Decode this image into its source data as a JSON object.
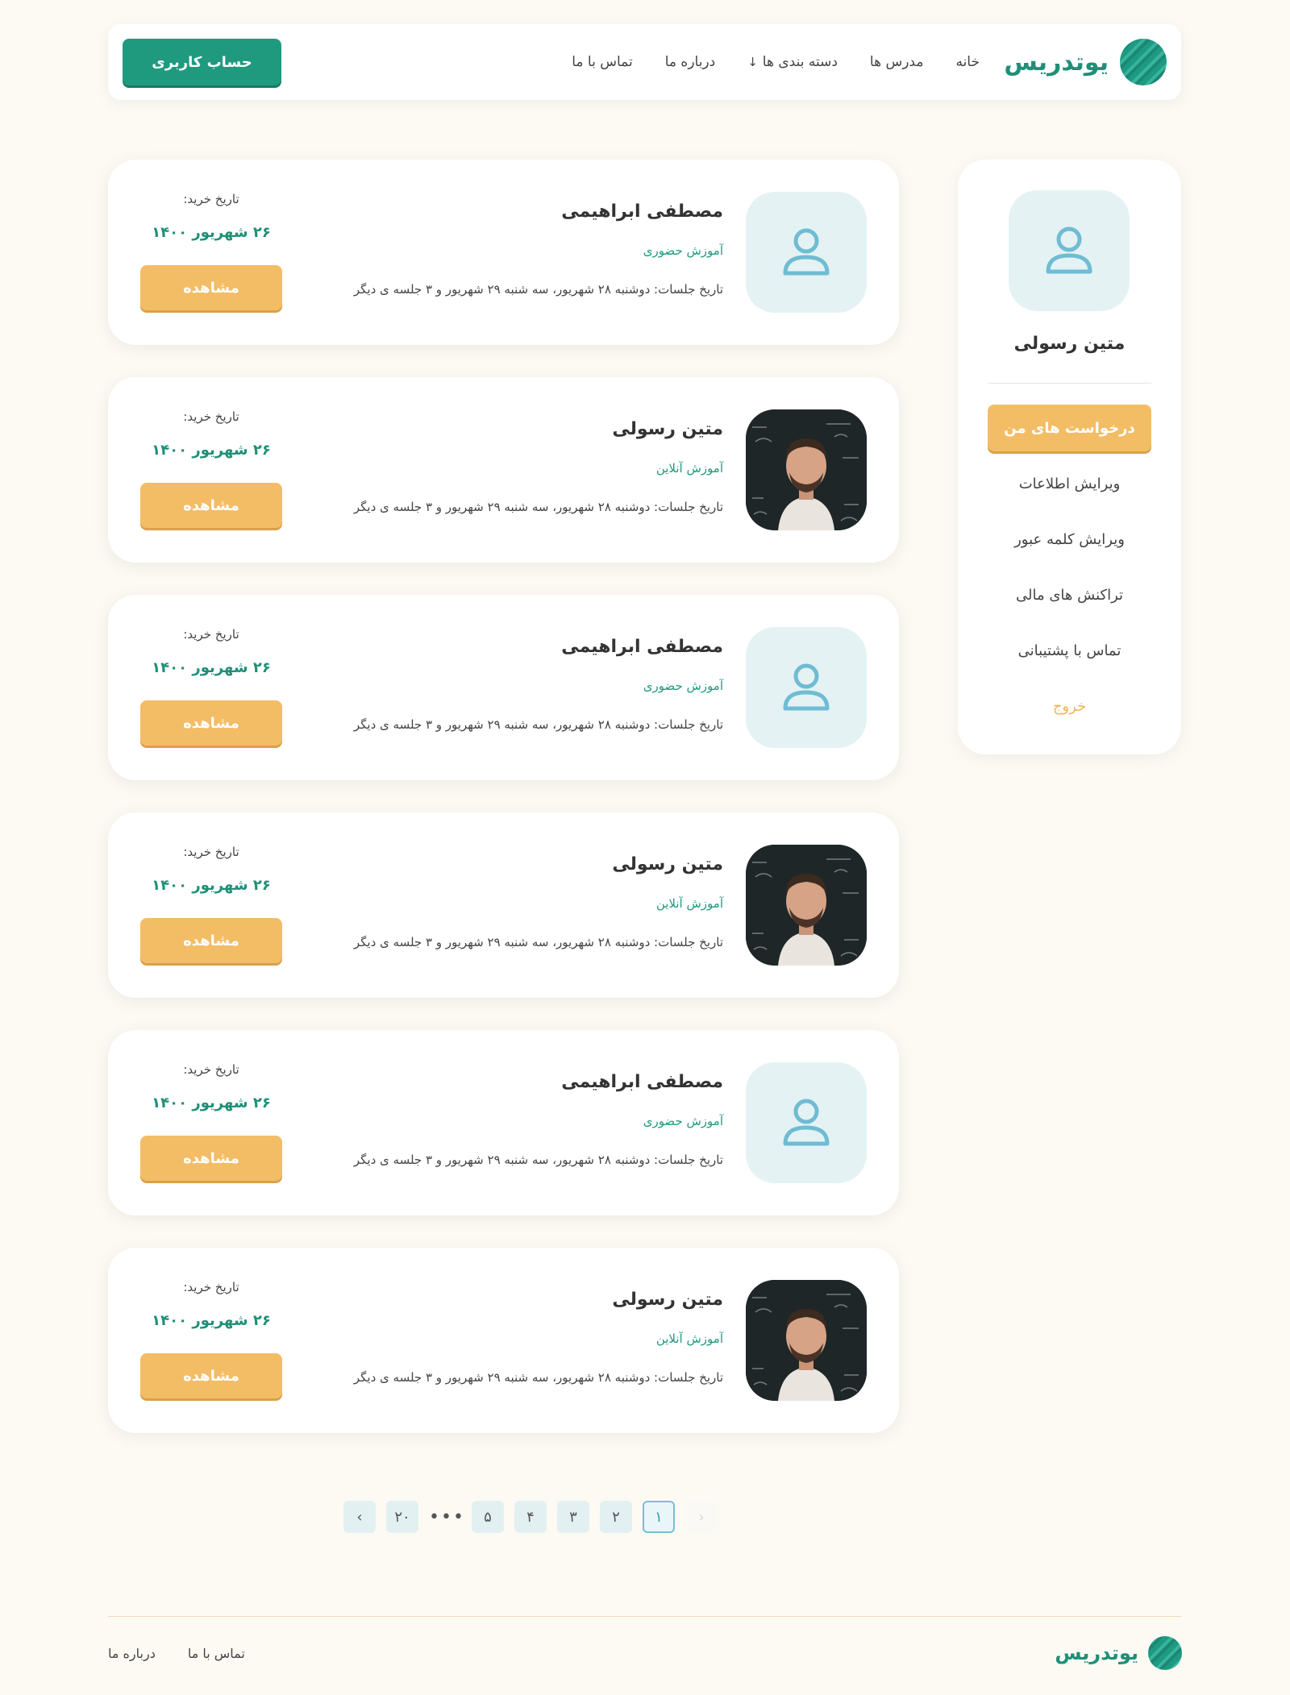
{
  "header": {
    "brand": "یوتدریس",
    "nav": [
      "خانه",
      "مدرس ها",
      "دسته بندی ها",
      "درباره ما",
      "تماس با ما"
    ],
    "account_button": "حساب کاربری"
  },
  "sidebar": {
    "user_name": "متین رسولی",
    "menu": [
      {
        "label": "درخواست های من",
        "active": true
      },
      {
        "label": "ویرایش اطلاعات",
        "active": false
      },
      {
        "label": "ویرایش کلمه عبور",
        "active": false
      },
      {
        "label": "تراکنش های مالی",
        "active": false
      },
      {
        "label": "تماس با پشتیبانی",
        "active": false
      },
      {
        "label": "خروج",
        "active": false
      }
    ]
  },
  "requests": [
    {
      "name": "مصطفی ابراهیمی",
      "type": "آموزش حضوری",
      "sessions": "تاریخ جلسات: دوشنبه ۲۸ شهریور، سه شنبه ۲۹ شهریور و ۳ جلسه ی دیگر",
      "purchase_label": "تاریخ خرید:",
      "purchase_date": "۲۶ شهریور ۱۴۰۰",
      "button": "مشاهده",
      "avatar": "placeholder"
    },
    {
      "name": "متین رسولی",
      "type": "آموزش آنلاین",
      "sessions": "تاریخ جلسات: دوشنبه ۲۸ شهریور، سه شنبه ۲۹ شهریور و ۳ جلسه ی دیگر",
      "purchase_label": "تاریخ خرید:",
      "purchase_date": "۲۶ شهریور ۱۴۰۰",
      "button": "مشاهده",
      "avatar": "photo"
    },
    {
      "name": "مصطفی ابراهیمی",
      "type": "آموزش حضوری",
      "sessions": "تاریخ جلسات: دوشنبه ۲۸ شهریور، سه شنبه ۲۹ شهریور و ۳ جلسه ی دیگر",
      "purchase_label": "تاریخ خرید:",
      "purchase_date": "۲۶ شهریور ۱۴۰۰",
      "button": "مشاهده",
      "avatar": "placeholder"
    },
    {
      "name": "متین رسولی",
      "type": "آموزش آنلاین",
      "sessions": "تاریخ جلسات: دوشنبه ۲۸ شهریور، سه شنبه ۲۹ شهریور و ۳ جلسه ی دیگر",
      "purchase_label": "تاریخ خرید:",
      "purchase_date": "۲۶ شهریور ۱۴۰۰",
      "button": "مشاهده",
      "avatar": "photo"
    },
    {
      "name": "مصطفی ابراهیمی",
      "type": "آموزش حضوری",
      "sessions": "تاریخ جلسات: دوشنبه ۲۸ شهریور، سه شنبه ۲۹ شهریور و ۳ جلسه ی دیگر",
      "purchase_label": "تاریخ خرید:",
      "purchase_date": "۲۶ شهریور ۱۴۰۰",
      "button": "مشاهده",
      "avatar": "placeholder"
    },
    {
      "name": "متین رسولی",
      "type": "آموزش آنلاین",
      "sessions": "تاریخ جلسات: دوشنبه ۲۸ شهریور، سه شنبه ۲۹ شهریور و ۳ جلسه ی دیگر",
      "purchase_label": "تاریخ خرید:",
      "purchase_date": "۲۶ شهریور ۱۴۰۰",
      "button": "مشاهده",
      "avatar": "photo"
    }
  ],
  "pagination": {
    "pages": [
      "۱",
      "۲",
      "۳",
      "۴",
      "۵"
    ],
    "ellipsis": "•••",
    "last": "۲۰",
    "current": "۱"
  },
  "footer": {
    "brand": "یوتدریس",
    "links": [
      "درباره ما",
      "تماس با ما"
    ]
  },
  "colors": {
    "primary": "#1f9a7f",
    "accent": "#f3bd66",
    "avatar_bg": "#e4f2f4",
    "avatar_icon": "#6fbcd3",
    "page_bg": "#fdfaf4"
  }
}
